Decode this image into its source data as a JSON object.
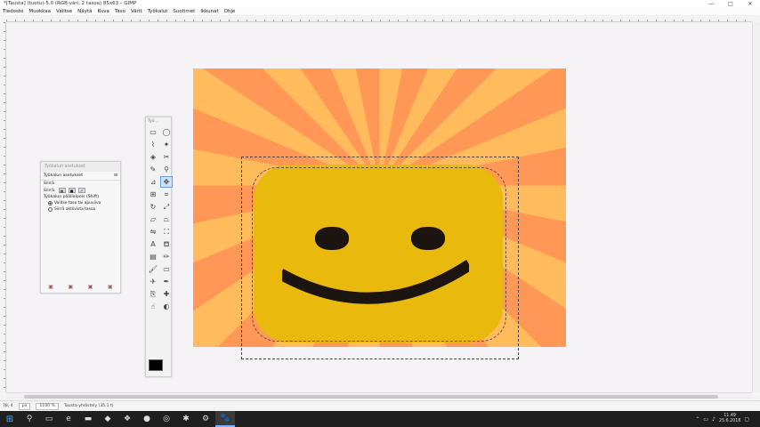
{
  "window": {
    "title": "*[Tausta] (tuotu)-5.0 (RGB-väri, 2 tasoa) 85x63 – GIMP",
    "controls": [
      "—",
      "□",
      "✕"
    ]
  },
  "menu": {
    "items": [
      "Tiedosto",
      "Muokkaa",
      "Valitse",
      "Näytä",
      "Kuva",
      "Taso",
      "Värit",
      "Työkalut",
      "Suotimet",
      "Ikkunat",
      "Ohje"
    ]
  },
  "toolbox": {
    "title": "Työ...",
    "tools": [
      {
        "icon": "rect-select-icon",
        "glyph": "▭"
      },
      {
        "icon": "ellipse-select-icon",
        "glyph": "◯"
      },
      {
        "icon": "free-select-icon",
        "glyph": "⌇"
      },
      {
        "icon": "fuzzy-select-icon",
        "glyph": "✦"
      },
      {
        "icon": "color-select-icon",
        "glyph": "◈"
      },
      {
        "icon": "scissors-select-icon",
        "glyph": "✂"
      },
      {
        "icon": "paths-icon",
        "glyph": "✎"
      },
      {
        "icon": "zoom-icon",
        "glyph": "⚲"
      },
      {
        "icon": "measure-icon",
        "glyph": "⊿"
      },
      {
        "icon": "move-icon",
        "glyph": "✥"
      },
      {
        "icon": "align-icon",
        "glyph": "⊞"
      },
      {
        "icon": "crop-icon",
        "glyph": "⌗"
      },
      {
        "icon": "rotate-icon",
        "glyph": "↻"
      },
      {
        "icon": "scale-icon",
        "glyph": "⤢"
      },
      {
        "icon": "shear-icon",
        "glyph": "▱"
      },
      {
        "icon": "perspective-icon",
        "glyph": "⏢"
      },
      {
        "icon": "flip-icon",
        "glyph": "⇋"
      },
      {
        "icon": "cage-icon",
        "glyph": "⛶"
      },
      {
        "icon": "text-icon",
        "glyph": "A"
      },
      {
        "icon": "bucket-fill-icon",
        "glyph": "⛾"
      },
      {
        "icon": "gradient-icon",
        "glyph": "▤"
      },
      {
        "icon": "pencil-icon",
        "glyph": "✏"
      },
      {
        "icon": "paintbrush-icon",
        "glyph": "🖌"
      },
      {
        "icon": "eraser-icon",
        "glyph": "▭"
      },
      {
        "icon": "airbrush-icon",
        "glyph": "✈"
      },
      {
        "icon": "ink-icon",
        "glyph": "✒"
      },
      {
        "icon": "clone-icon",
        "glyph": "⎘"
      },
      {
        "icon": "heal-icon",
        "glyph": "✚"
      },
      {
        "icon": "smudge-icon",
        "glyph": "☝"
      },
      {
        "icon": "dodge-burn-icon",
        "glyph": "◐"
      }
    ],
    "active_index": 9
  },
  "tool_options": {
    "title": "Työkalun asetukset",
    "tab_label": "Työkalun asetukset",
    "section": "Siirrä",
    "move_label": "Siirrä:",
    "toggle_label": "Työkalun päälle/pois (Shift)",
    "radio": [
      {
        "label": "Valitse taso tai apuviiva",
        "checked": true
      },
      {
        "label": "Siirrä aktiivista tasoa",
        "checked": false
      }
    ]
  },
  "status": {
    "coords": "78, 4",
    "unit": "px",
    "zoom": "1100 %",
    "message": "Tausta-yhdistely (35.1 t)"
  },
  "taskbar": {
    "time": "11.49",
    "date": "25.6.2018"
  }
}
